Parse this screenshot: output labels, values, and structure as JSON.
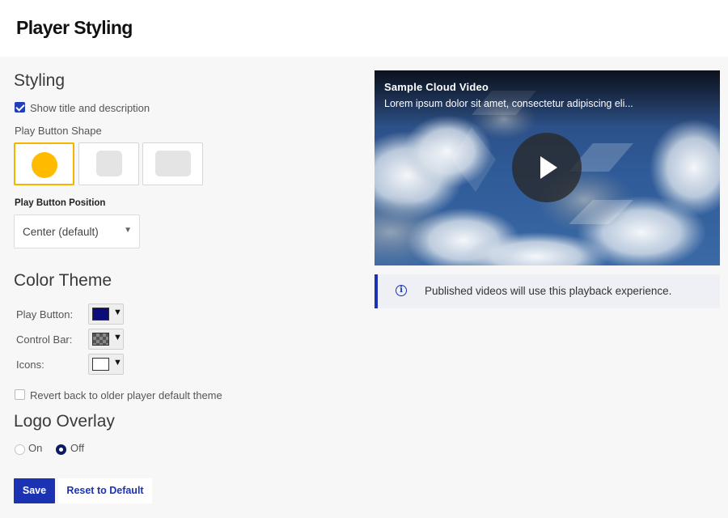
{
  "header": {
    "title": "Player Styling"
  },
  "styling": {
    "heading": "Styling",
    "show_title_label": "Show title and description",
    "show_title_checked": true,
    "shape_label": "Play Button Shape",
    "shapes": [
      "circle",
      "rounded-square",
      "rounded-rectangle"
    ],
    "selected_shape": "circle",
    "position_label": "Play Button Position",
    "position_value": "Center (default)"
  },
  "color_theme": {
    "heading": "Color Theme",
    "play_button_label": "Play Button:",
    "play_button_color": "#0b0b7a",
    "control_bar_label": "Control Bar:",
    "control_bar_color": "checkered-gray",
    "icons_label": "Icons:",
    "icons_color": "#ffffff",
    "revert_label": "Revert back to older player default theme",
    "revert_checked": false
  },
  "logo_overlay": {
    "heading": "Logo Overlay",
    "on_label": "On",
    "off_label": "Off",
    "selected": "Off"
  },
  "actions": {
    "save_label": "Save",
    "reset_label": "Reset to Default"
  },
  "preview": {
    "video_title": "Sample Cloud Video",
    "video_description": "Lorem ipsum dolor sit amet, consectetur adipiscing eli...",
    "info_text": "Published videos will use this playback experience.",
    "info_icon": "i"
  },
  "colors": {
    "accent": "#1b33b3",
    "selected_border": "#f5b400",
    "play_shape_fill": "#ffbb00"
  }
}
